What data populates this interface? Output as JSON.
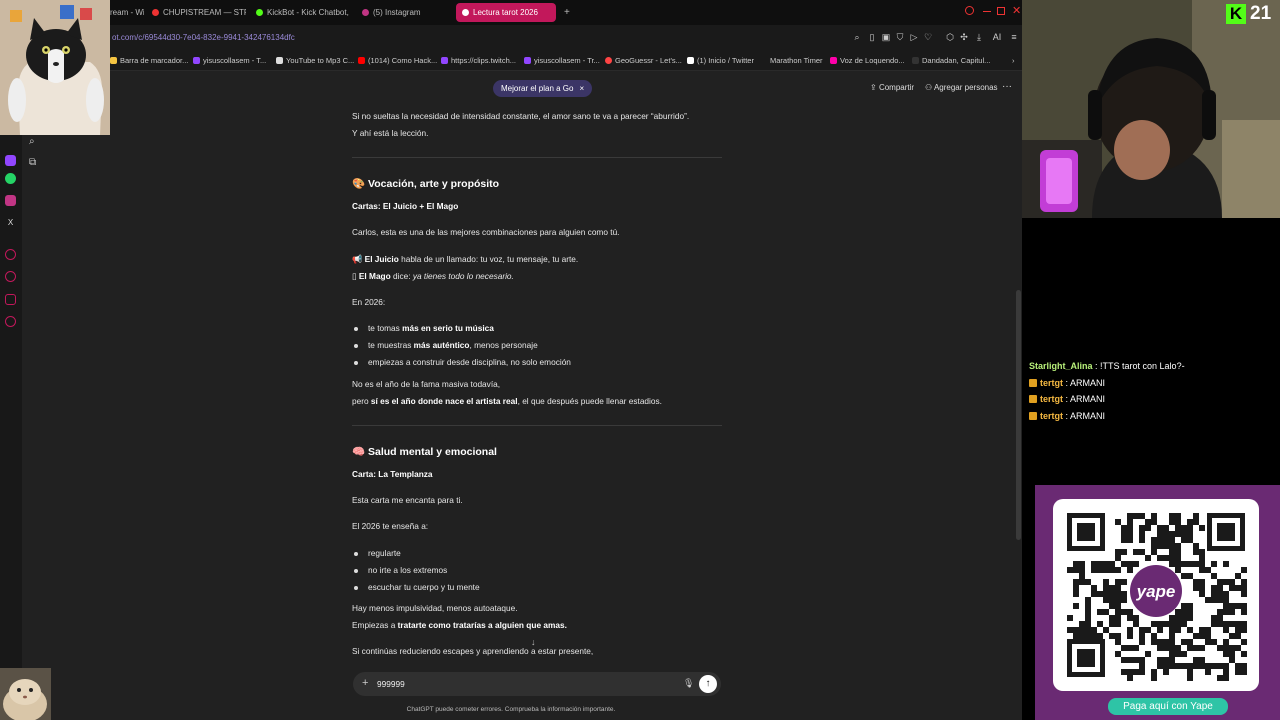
{
  "tabs": [
    {
      "label": "ream - Wi",
      "color": "#777"
    },
    {
      "label": "CHUPISTREAM — STREA",
      "color": "#e33"
    },
    {
      "label": "KickBot - Kick Chatbot, Al",
      "color": "#53fc18"
    },
    {
      "label": "(5) Instagram",
      "color": "#c13584"
    },
    {
      "label": "Lectura tarot 2026",
      "color": "#fff"
    }
  ],
  "new_tab": "+",
  "address": {
    "url": "ot.com/c/69544d30-7e04-832e-9941-342476134dfc"
  },
  "toolbar_icons": [
    "zoom-icon",
    "bookmark-icon",
    "screenshot-icon",
    "extension-icon",
    "shield-icon",
    "favorite-icon",
    "puzzle-icon",
    "profile-icon",
    "download-icon",
    "ai-icon",
    "menu-icon"
  ],
  "toolbar_ai_label": "AI",
  "bookmarks": [
    {
      "label": "Barra de marcador...",
      "color": "#f5c542"
    },
    {
      "label": "yisuscollasem - T...",
      "color": "#9146ff"
    },
    {
      "label": "YouTube to Mp3 C...",
      "color": "#ddd"
    },
    {
      "label": "(1014) Como Hack...",
      "color": "#f00"
    },
    {
      "label": "https://clips.twitch...",
      "color": "#9146ff"
    },
    {
      "label": "yisuscollasem - Tr...",
      "color": "#9146ff"
    },
    {
      "label": "GeoGuessr - Let's...",
      "color": "#f44"
    },
    {
      "label": "(1) Inicio / Twitter",
      "color": "#fff"
    },
    {
      "label": "Marathon Timer",
      "color": "#333"
    },
    {
      "label": "Voz de Loquendo...",
      "color": "#f0a"
    },
    {
      "label": "Dandadan, Capitul...",
      "color": "#333"
    }
  ],
  "header": {
    "upgrade": "Mejorar el plan a Go",
    "upgrade_close": "×",
    "share": "Compartir",
    "add_people": "Agregar personas",
    "more": "···"
  },
  "content": {
    "p1": "Si no sueltas la necesidad de intensidad constante, el amor sano te va a parecer “aburrido”.",
    "p2": "Y ahí está la lección.",
    "s1_emoji": "🎨",
    "s1_title": "Vocación, arte y propósito",
    "s1_cards": "Cartas: El Juicio + El Mago",
    "s1_intro": "Carlos, esta es una de las mejores combinaciones para alguien como tú.",
    "s1_l1_emoji": "📢",
    "s1_l1_bold": "El Juicio",
    "s1_l1_rest": " habla de un llamado: tu voz, tu mensaje, tu arte.",
    "s1_l2_glyph": "▯",
    "s1_l2_bold": "El Mago",
    "s1_l2_rest": " dice: ",
    "s1_l2_italic": "ya tienes todo lo necesario.",
    "s1_year": "En 2026:",
    "s1_b1_pre": "te tomas ",
    "s1_b1_bold": "más en serio tu música",
    "s1_b2_pre": "te muestras ",
    "s1_b2_bold": "más auténtico",
    "s1_b2_post": ", menos personaje",
    "s1_b3": "empiezas a construir desde disciplina, no solo emoción",
    "s1_c1": "No es el año de la fama masiva todavía,",
    "s1_c2_pre": "pero ",
    "s1_c2_bold": "sí es el año donde nace el artista real",
    "s1_c2_post": ", el que después puede llenar estadios.",
    "s2_emoji": "🧠",
    "s2_title": "Salud mental y emocional",
    "s2_card": "Carta: La Templanza",
    "s2_intro": "Esta carta me encanta para ti.",
    "s2_teaches": "El 2026 te enseña a:",
    "s2_b1": "regularte",
    "s2_b2": "no irte a los extremos",
    "s2_b3": "escuchar tu cuerpo y tu mente",
    "s2_c1": "Hay menos impulsividad, menos autoataque.",
    "s2_c2_pre": "Empiezas a ",
    "s2_c2_bold": "tratarte como tratarías a alguien que amas.",
    "s2_c3": "Si continúas reduciendo escapes y aprendiendo a estar presente,"
  },
  "composer": {
    "value": "999999",
    "plus": "+",
    "mic": "🎙",
    "send": "↑"
  },
  "scroll_down": "↓",
  "disclaimer": "ChatGPT puede cometer errores. Comprueba la información importante.",
  "stream": {
    "kick_logo": "K",
    "viewer_count": "21",
    "chat": [
      {
        "user": "Starlight_Alina",
        "sep": " : ",
        "text": "!TTS tarot con Lalo?-",
        "badge": false
      },
      {
        "user": "tertgt",
        "sep": " : ",
        "text": "ARMANI",
        "badge": true
      },
      {
        "user": "tertgt",
        "sep": " : ",
        "text": "ARMANI",
        "badge": true
      },
      {
        "user": "tertgt",
        "sep": " : ",
        "text": "ARMANI",
        "badge": true
      }
    ],
    "yape_logo": "yape",
    "yape_button": "Paga aquí con Yape"
  },
  "colors": {
    "accent_tab": "#c2185b",
    "kick_green": "#53fc18",
    "yape_purple": "#6a2a73",
    "yape_button": "#2ec4a6"
  }
}
